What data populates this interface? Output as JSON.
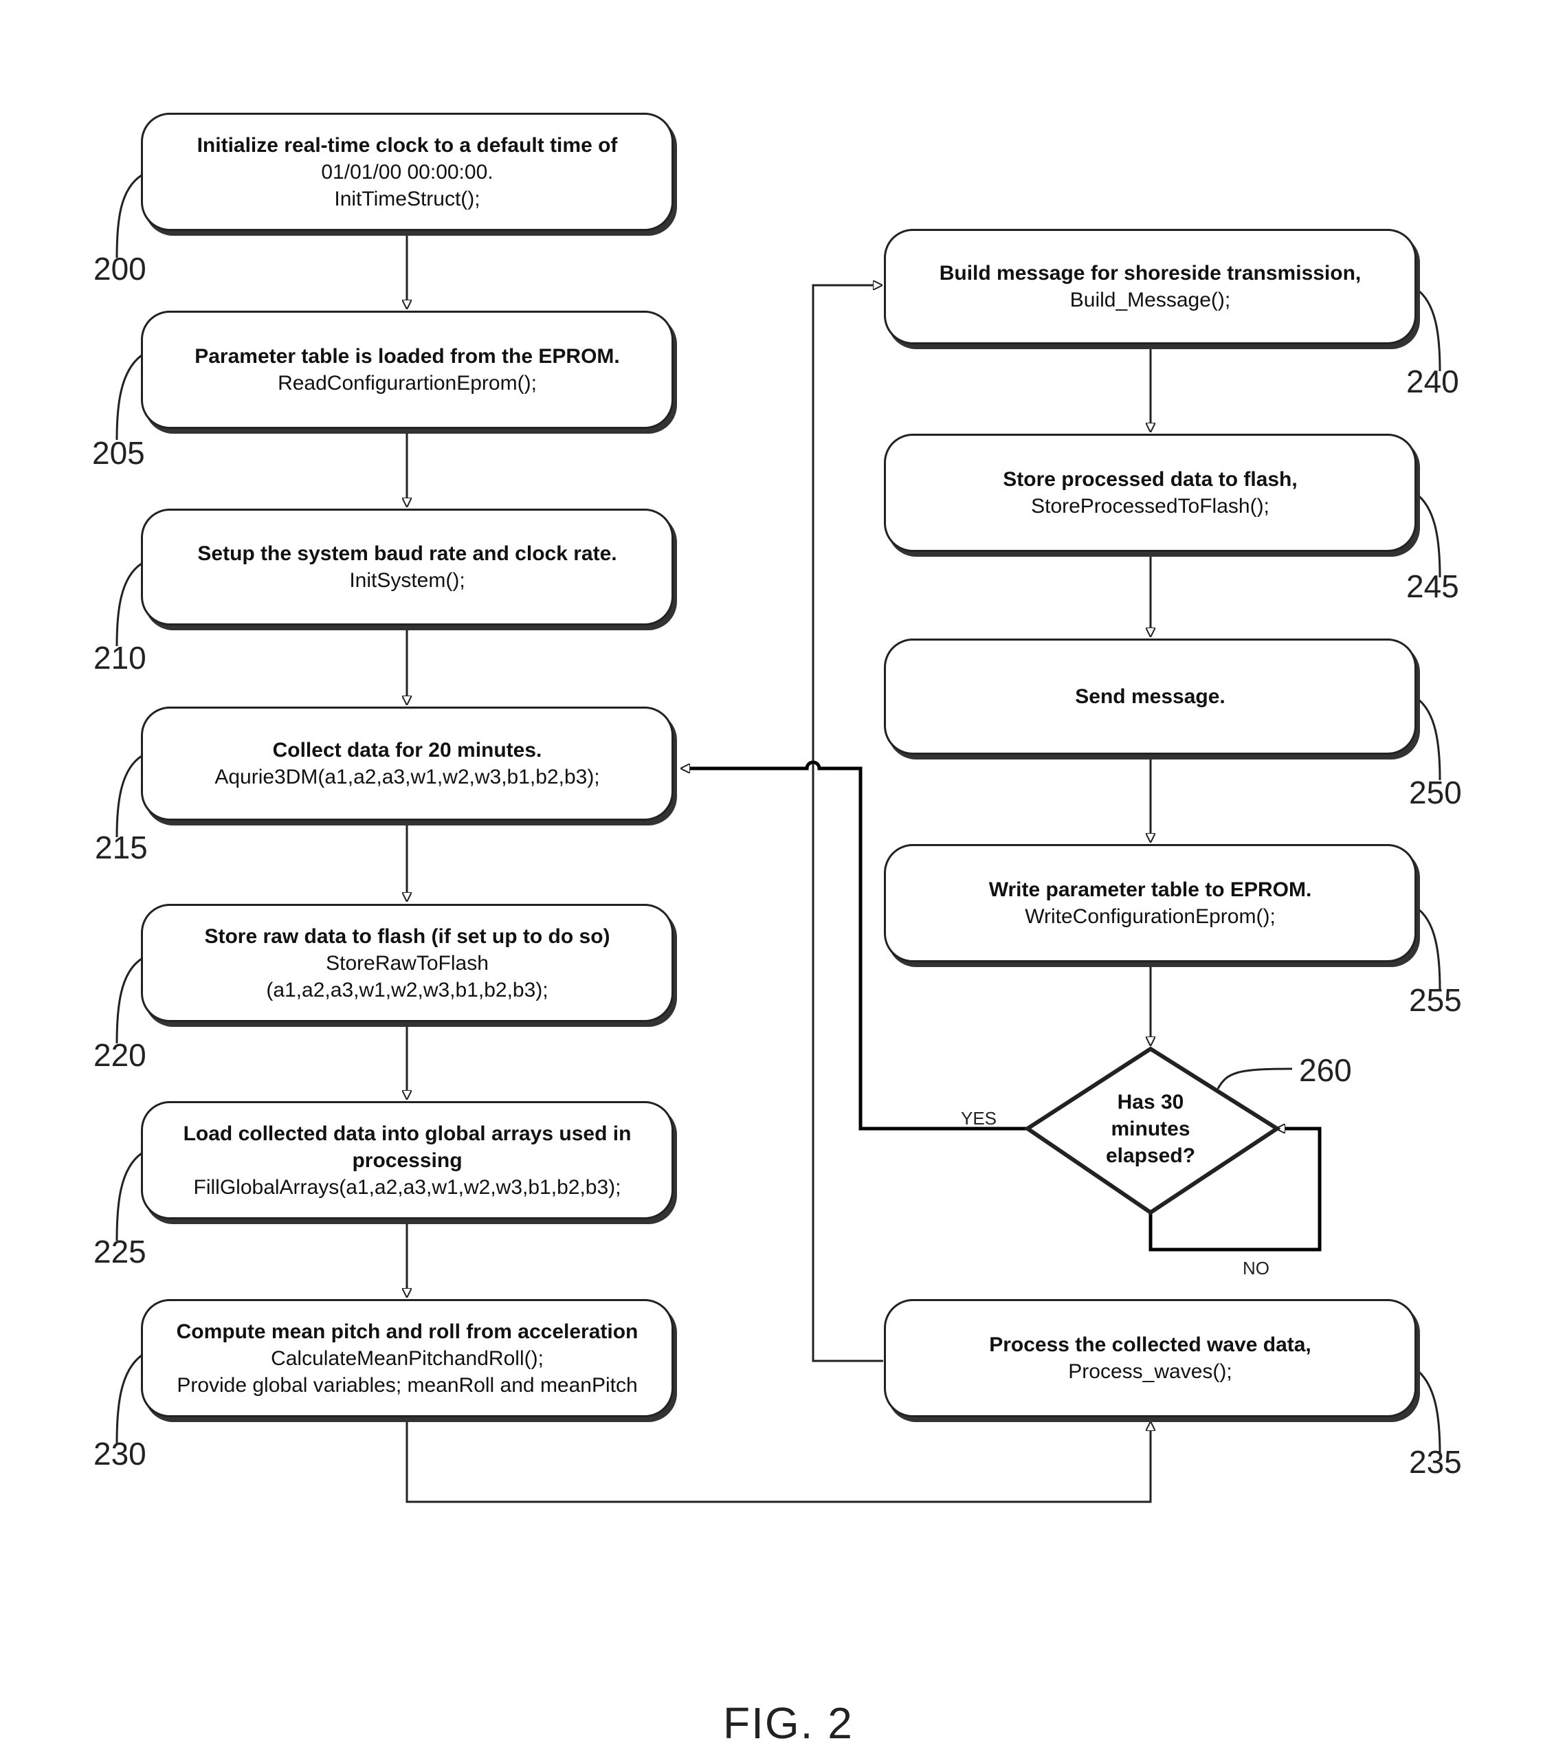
{
  "figure_label": "FIG. 2",
  "steps": {
    "s200": {
      "ref": "200",
      "title": "Initialize real-time clock to a default time of",
      "lines": [
        "01/01/00 00:00:00.",
        "InitTimeStruct();"
      ]
    },
    "s205": {
      "ref": "205",
      "title": "Parameter table is loaded from the EPROM.",
      "lines": [
        "ReadConfigurartionEprom();"
      ]
    },
    "s210": {
      "ref": "210",
      "title": "Setup the system baud rate and clock rate.",
      "lines": [
        "InitSystem();"
      ]
    },
    "s215": {
      "ref": "215",
      "title": "Collect data for 20 minutes.",
      "lines": [
        "Aqurie3DM(a1,a2,a3,w1,w2,w3,b1,b2,b3);"
      ]
    },
    "s220": {
      "ref": "220",
      "title": "Store raw data to flash (if set up to do so)",
      "lines": [
        "StoreRawToFlash",
        "(a1,a2,a3,w1,w2,w3,b1,b2,b3);"
      ]
    },
    "s225": {
      "ref": "225",
      "title": "Load collected data into global arrays used in processing",
      "lines": [
        "FillGlobalArrays(a1,a2,a3,w1,w2,w3,b1,b2,b3);"
      ]
    },
    "s230": {
      "ref": "230",
      "title": "Compute mean pitch and roll from acceleration",
      "lines": [
        "CalculateMeanPitchandRoll();",
        "Provide global variables; meanRoll and meanPitch"
      ]
    },
    "s235": {
      "ref": "235",
      "title": "Process the collected wave data,",
      "lines": [
        "Process_waves();"
      ]
    },
    "s240": {
      "ref": "240",
      "title": "Build message for shoreside transmission,",
      "lines": [
        "Build_Message();"
      ]
    },
    "s245": {
      "ref": "245",
      "title": "Store processed data to flash,",
      "lines": [
        "StoreProcessedToFlash();"
      ]
    },
    "s250": {
      "ref": "250",
      "title": "Send message.",
      "lines": []
    },
    "s255": {
      "ref": "255",
      "title": "Write parameter table to EPROM.",
      "lines": [
        "WriteConfigurationEprom();"
      ]
    }
  },
  "decision": {
    "ref": "260",
    "lines": [
      "Has 30",
      "minutes",
      "elapsed?"
    ],
    "yes_label": "YES",
    "no_label": "NO"
  }
}
